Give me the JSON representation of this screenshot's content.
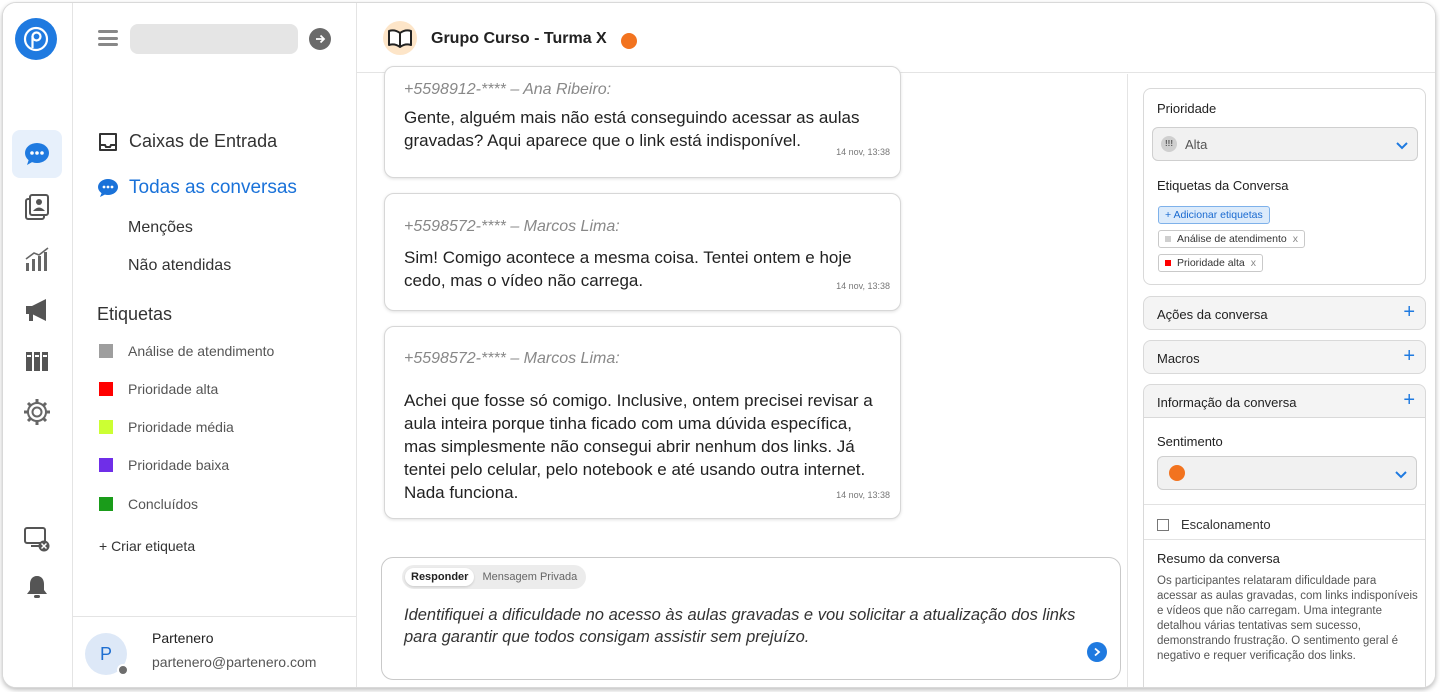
{
  "sidebar": {
    "nav_inbox": "Caixas de Entrada",
    "nav_all": "Todas as conversas",
    "nav_mentions": "Menções",
    "nav_unattended": "Não atendidas",
    "labels_heading": "Etiquetas",
    "labels": [
      {
        "name": "Análise de atendimento",
        "color": "#9e9e9e"
      },
      {
        "name": "Prioridade alta",
        "color": "#ff0000"
      },
      {
        "name": "Prioridade média",
        "color": "#ccff33"
      },
      {
        "name": "Prioridade baixa",
        "color": "#6f2ee8"
      },
      {
        "name": "Concluídos",
        "color": "#1a9c1a"
      }
    ],
    "create_label": "+ Criar etiqueta",
    "user": {
      "initial": "P",
      "name": "Partenero",
      "email": "partenero@partenero.com"
    }
  },
  "header": {
    "title": "Grupo Curso - Turma X",
    "status_color": "#f2731f"
  },
  "messages": [
    {
      "author": "+5598912-**** – Ana Ribeiro:",
      "text": "Gente, alguém mais não está conseguindo acessar as aulas gravadas? Aqui aparece que o link está indisponível.",
      "time": "14 nov, 13:38"
    },
    {
      "author": "+5598572-**** – Marcos Lima:",
      "text": "Sim! Comigo acontece a mesma coisa. Tentei ontem e hoje cedo, mas o vídeo não carrega.",
      "time": "14 nov, 13:38"
    },
    {
      "author": "+5598572-**** – Marcos Lima:",
      "text": "Achei que fosse só comigo. Inclusive, ontem precisei revisar a aula inteira porque tinha ficado com uma dúvida específica, mas simplesmente não consegui abrir nenhum dos links. Já tentei pelo celular, pelo notebook e até usando outra internet. Nada funciona.",
      "time": "14 nov, 13:38"
    }
  ],
  "composer": {
    "tab_reply": "Responder",
    "tab_private": "Mensagem Privada",
    "text": "Identifiquei a dificuldade no acesso às aulas gravadas e vou solicitar a atualização dos links para garantir que todos consigam assistir sem prejuízo."
  },
  "panel": {
    "priority_label": "Prioridade",
    "priority_value": "Alta",
    "tags_label": "Etiquetas da Conversa",
    "add_tags": "+ Adicionar etiquetas",
    "tags": [
      {
        "name": "Análise de atendimento",
        "color": "#cfcfcf"
      },
      {
        "name": "Prioridade alta",
        "color": "#ff0000"
      }
    ],
    "tag_remove": "x",
    "actions": "Ações da conversa",
    "macros": "Macros",
    "info": "Informação da conversa",
    "sentiment_label": "Sentimento",
    "sentiment_color": "#f2731f",
    "escalation": "Escalonamento",
    "summary_title": "Resumo da conversa",
    "summary": "Os participantes relataram dificuldade para acessar as aulas gravadas, com links indisponíveis e vídeos que não carregam. Uma integrante detalhou várias tentativas sem sucesso, demonstrando frustração. O sentimento geral é negativo e requer verificação dos links."
  }
}
